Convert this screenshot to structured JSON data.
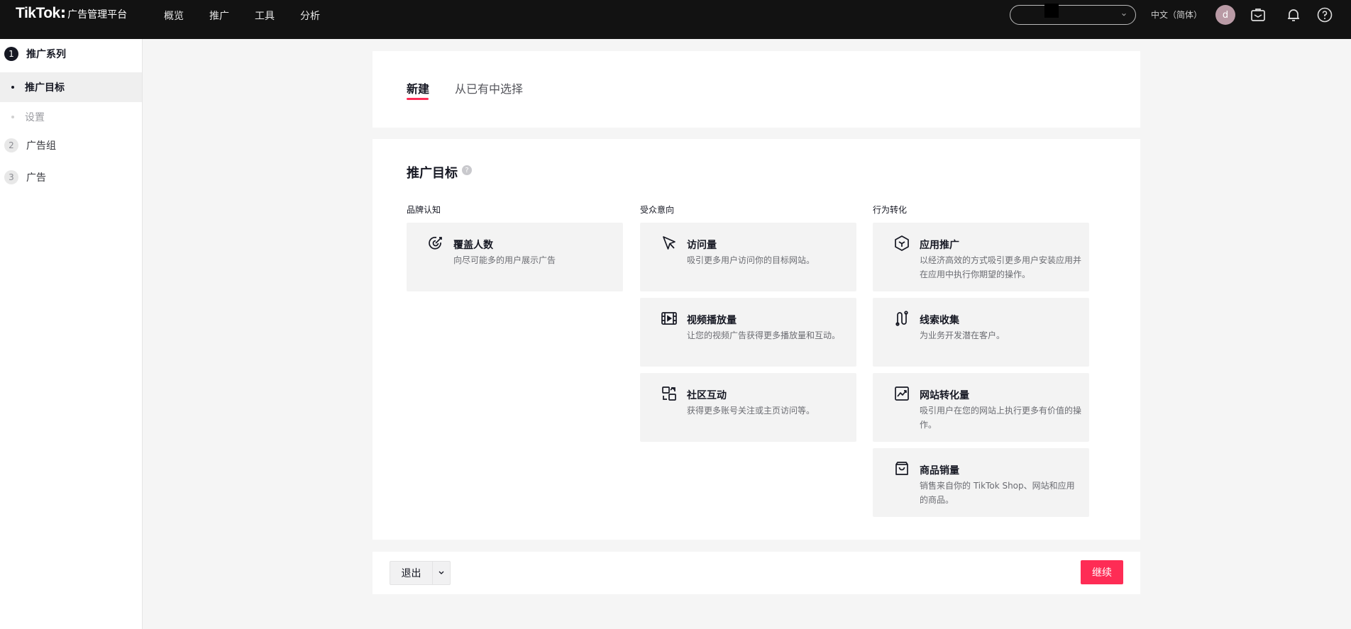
{
  "topbar": {
    "logo_main": "TikTok",
    "logo_colon": ":",
    "logo_sub": "广告管理平台",
    "nav": [
      "概览",
      "推广",
      "工具",
      "分析"
    ],
    "language": "中文（简体）",
    "avatar_initial": "d"
  },
  "sidebar": {
    "steps": [
      {
        "num": "1",
        "label": "推广系列"
      },
      {
        "num": "2",
        "label": "广告组"
      },
      {
        "num": "3",
        "label": "广告"
      }
    ],
    "subs": [
      "推广目标",
      "设置"
    ]
  },
  "tabs": [
    "新建",
    "从已有中选择"
  ],
  "objective": {
    "title": "推广目标",
    "help": "?",
    "columns": [
      {
        "title": "品牌认知",
        "options": [
          {
            "title": "覆盖人数",
            "desc": "向尽可能多的用户展示广告",
            "icon": "reach-icon"
          }
        ]
      },
      {
        "title": "受众意向",
        "options": [
          {
            "title": "访问量",
            "desc": "吸引更多用户访问你的目标网站。",
            "icon": "cursor-icon"
          },
          {
            "title": "视频播放量",
            "desc": "让您的视频广告获得更多播放量和互动。",
            "icon": "video-icon"
          },
          {
            "title": "社区互动",
            "desc": "获得更多账号关注或主页访问等。",
            "icon": "community-icon"
          }
        ]
      },
      {
        "title": "行为转化",
        "options": [
          {
            "title": "应用推广",
            "desc": "以经济高效的方式吸引更多用户安装应用并在应用中执行你期望的操作。",
            "icon": "app-icon"
          },
          {
            "title": "线索收集",
            "desc": "为业务开发潜在客户。",
            "icon": "lead-icon"
          },
          {
            "title": "网站转化量",
            "desc": "吸引用户在您的网站上执行更多有价值的操作。",
            "icon": "conversion-icon"
          },
          {
            "title": "商品销量",
            "desc": "销售来自你的 TikTok Shop、网站和应用的商品。",
            "icon": "shopping-bag-icon"
          }
        ]
      }
    ]
  },
  "footer": {
    "exit_label": "退出",
    "continue_label": "继续"
  },
  "colors": {
    "accent": "#fe2c55",
    "topbar": "#121212"
  }
}
